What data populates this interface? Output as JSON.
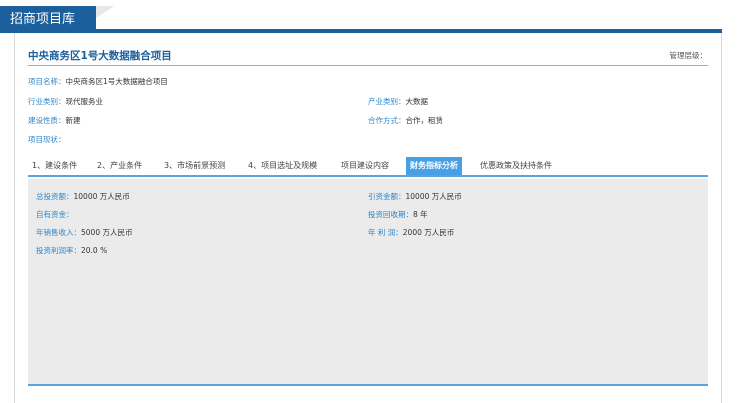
{
  "header": {
    "tab_label": "招商项目库"
  },
  "project": {
    "title": "中央商务区1号大数据融合项目",
    "management_label": "管理层级："
  },
  "info": {
    "name_label": "项目名称：",
    "name_value": "中央商务区1号大数据融合项目",
    "industry_label": "行业类别：",
    "industry_value": "现代服务业",
    "product_label": "产业类别：",
    "product_value": "大数据",
    "nature_label": "建设性质：",
    "nature_value": "新建",
    "coop_label": "合作方式：",
    "coop_value": "合作，租赁",
    "status_label": "项目现状：",
    "status_value": ""
  },
  "tabs": [
    {
      "label": "1、建设条件"
    },
    {
      "label": "2、产业条件"
    },
    {
      "label": "3、市场前景预测"
    },
    {
      "label": "4、项目选址及规模"
    },
    {
      "label": "项目建设内容"
    },
    {
      "label": "财务指标分析",
      "active": true
    },
    {
      "label": "优惠政策及扶持条件"
    }
  ],
  "finance": {
    "total_invest_label": "总投资额：",
    "total_invest_value": "10000 万人民币",
    "introduce_label": "引资金额：",
    "introduce_value": "10000 万人民币",
    "own_funds_label": "自有资金：",
    "own_funds_value": "",
    "payback_label": "投资回收期：",
    "payback_value": "8 年",
    "annual_sales_label": "年销售收入：",
    "annual_sales_value": "5000 万人民币",
    "annual_profit_label": "年 利 润：",
    "annual_profit_value": "2000 万人民币",
    "roi_label": "投资利润率：",
    "roi_value": "20.0 %"
  },
  "colors": {
    "brand": "#1b5f9c",
    "label_blue": "#2e86c9",
    "active_tab": "#46a0e6",
    "content_bg": "#ebebeb"
  }
}
